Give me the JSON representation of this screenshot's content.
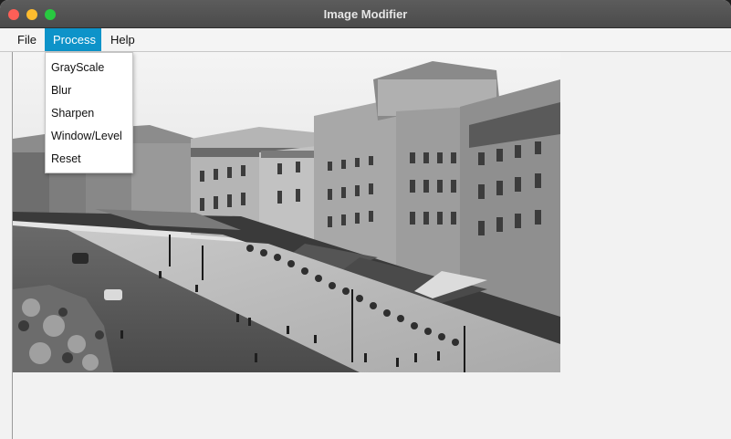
{
  "window": {
    "title": "Image Modifier"
  },
  "menubar": {
    "items": [
      {
        "label": "File"
      },
      {
        "label": "Process"
      },
      {
        "label": "Help"
      }
    ]
  },
  "process_menu": {
    "items": [
      {
        "label": "GrayScale"
      },
      {
        "label": "Blur"
      },
      {
        "label": "Sharpen"
      },
      {
        "label": "Window/Level"
      },
      {
        "label": "Reset"
      }
    ]
  },
  "colors": {
    "menu_highlight": "#0d93c9",
    "titlebar": "#545454"
  }
}
